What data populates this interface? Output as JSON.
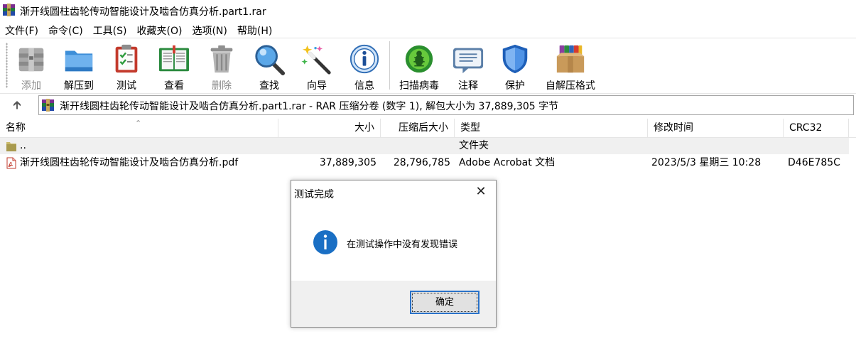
{
  "window": {
    "title": "渐开线圆柱齿轮传动智能设计及啮合仿真分析.part1.rar"
  },
  "menu": [
    "文件(F)",
    "命令(C)",
    "工具(S)",
    "收藏夹(O)",
    "选项(N)",
    "帮助(H)"
  ],
  "toolbar": {
    "add": "添加",
    "extract": "解压到",
    "test": "测试",
    "view": "查看",
    "delete": "删除",
    "find": "查找",
    "wizard": "向导",
    "info": "信息",
    "virus": "扫描病毒",
    "comment": "注释",
    "protect": "保护",
    "sfx": "自解压格式"
  },
  "address": {
    "path": "渐开线圆柱齿轮传动智能设计及啮合仿真分析.part1.rar - RAR 压缩分卷 (数字 1), 解包大小为 37,889,305 字节"
  },
  "columns": {
    "name": "名称",
    "size": "大小",
    "packed": "压缩后大小",
    "type": "类型",
    "modified": "修改时间",
    "crc": "CRC32"
  },
  "rows": [
    {
      "name": "..",
      "size": "",
      "packed": "",
      "type": "文件夹",
      "modified": "",
      "crc": ""
    },
    {
      "name": "渐开线圆柱齿轮传动智能设计及啮合仿真分析.pdf",
      "size": "37,889,305",
      "packed": "28,796,785",
      "type": "Adobe Acrobat 文档",
      "modified": "2023/5/3 星期三 10:28",
      "crc": "D46E785C"
    }
  ],
  "dialog": {
    "title": "测试完成",
    "message": "在测试操作中没有发现错误",
    "ok": "确定",
    "close_glyph": "✕"
  },
  "colors": {
    "accent": "#2a72c9",
    "info_blue": "#1a6fc4"
  }
}
